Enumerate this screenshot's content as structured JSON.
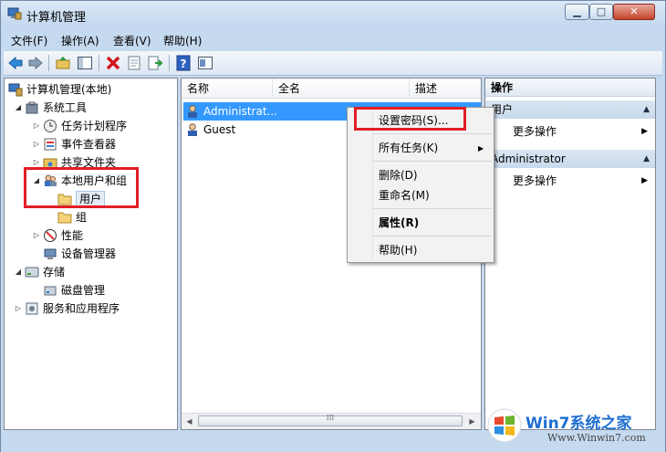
{
  "window": {
    "title": "计算机管理"
  },
  "window_buttons": {
    "minimize": "▁",
    "maximize": "□",
    "close": "✕"
  },
  "menubar": [
    "文件(F)",
    "操作(A)",
    "查看(V)",
    "帮助(H)"
  ],
  "toolbar_icons": [
    "back-arrow-icon",
    "forward-arrow-icon",
    "up-folder-icon",
    "show-hide-tree-icon",
    "delete-x-icon",
    "properties-icon",
    "export-list-icon",
    "help-icon",
    "console-tree-icon"
  ],
  "tree": {
    "items": [
      {
        "label": "计算机管理(本地)",
        "expander": ""
      },
      {
        "label": "系统工具",
        "expander": "◢"
      },
      {
        "label": "任务计划程序",
        "expander": "▷"
      },
      {
        "label": "事件查看器",
        "expander": "▷"
      },
      {
        "label": "共享文件夹",
        "expander": "▷"
      },
      {
        "label": "本地用户和组",
        "expander": "◢"
      },
      {
        "label": "用户",
        "expander": ""
      },
      {
        "label": "组",
        "expander": ""
      },
      {
        "label": "性能",
        "expander": "▷"
      },
      {
        "label": "设备管理器",
        "expander": ""
      },
      {
        "label": "存储",
        "expander": "◢"
      },
      {
        "label": "磁盘管理",
        "expander": ""
      },
      {
        "label": "服务和应用程序",
        "expander": "▷"
      }
    ]
  },
  "list": {
    "columns": [
      "名称",
      "全名",
      "描述"
    ],
    "rows": [
      {
        "name": "Administrat...",
        "selected": true
      },
      {
        "name": "Guest",
        "selected": false
      }
    ],
    "scroll_grip": "⁞⁞⁞",
    "scroll_left": "◀",
    "scroll_right": "▶"
  },
  "actions": {
    "header": "操作",
    "sections": [
      {
        "title": "用户",
        "item": "更多操作"
      },
      {
        "title": "Administrator",
        "item": "更多操作"
      }
    ],
    "collapse_glyph": "▲",
    "more_arrow": "▶"
  },
  "context_menu": {
    "items": [
      "设置密码(S)...",
      "所有任务(K)",
      "删除(D)",
      "重命名(M)",
      "属性(R)",
      "帮助(H)"
    ],
    "submenu_arrow": "▶"
  },
  "watermark": {
    "brand": "Win7系统之家",
    "url": "Www.Winwin7.com"
  },
  "colors": {
    "selection": "#3399ff",
    "highlight_box": "#e21e26"
  }
}
